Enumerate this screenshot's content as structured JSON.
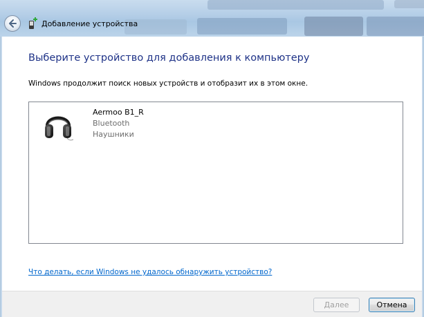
{
  "window": {
    "title": "Добавление устройства"
  },
  "main": {
    "heading": "Выберите устройство для добавления к компьютеру",
    "description": "Windows продолжит поиск новых устройств и отобразит их в этом окне.",
    "devices": [
      {
        "name": "Aermoo B1_R",
        "type": "Bluetooth",
        "category": "Наушники",
        "icon": "headphones-icon"
      }
    ],
    "help_link": "Что делать, если Windows не удалось обнаружить устройство?"
  },
  "footer": {
    "next_label": "Далее",
    "cancel_label": "Отмена"
  },
  "colors": {
    "heading": "#1e3287",
    "link": "#0066cc",
    "secondary_text": "#6d6d6d"
  }
}
